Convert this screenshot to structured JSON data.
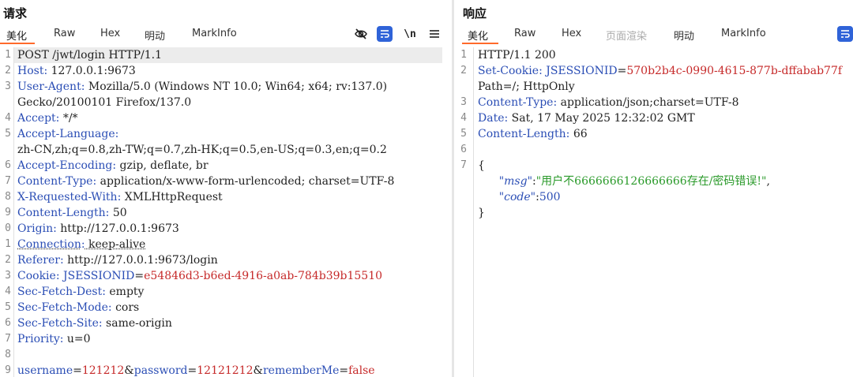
{
  "request": {
    "title": "请求",
    "tabs": [
      "美化",
      "Raw",
      "Hex",
      "明动",
      "MarkInfo"
    ],
    "active_tab": "美化",
    "toolbar": {
      "wrap_symbol": "\\n"
    },
    "lines": [
      {
        "num": "1",
        "text": "POST /jwt/login HTTP/1.1"
      },
      {
        "num": "2",
        "key": "Host",
        "value": " 127.0.0.1:9673"
      },
      {
        "num": "3",
        "key": "User-Agent",
        "value": " Mozilla/5.0 (Windows NT 10.0; Win64; x64; rv:137.0)"
      },
      {
        "num": "",
        "text": "Gecko/20100101 Firefox/137.0"
      },
      {
        "num": "4",
        "key": "Accept",
        "value": " */*"
      },
      {
        "num": "5",
        "key": "Accept-Language",
        "value": ""
      },
      {
        "num": "",
        "text": "zh-CN,zh;q=0.8,zh-TW;q=0.7,zh-HK;q=0.5,en-US;q=0.3,en;q=0.2"
      },
      {
        "num": "6",
        "key": "Accept-Encoding",
        "value": " gzip, deflate, br"
      },
      {
        "num": "7",
        "key": "Content-Type",
        "value": " application/x-www-form-urlencoded; charset=UTF-8"
      },
      {
        "num": "8",
        "key": "X-Requested-With",
        "value": " XMLHttpRequest"
      },
      {
        "num": "9",
        "key": "Content-Length",
        "value": " 50"
      },
      {
        "num": "0",
        "key": "Origin",
        "value": " http://127.0.0.1:9673"
      },
      {
        "num": "1",
        "key": "Connection",
        "value": " keep-alive"
      },
      {
        "num": "2",
        "key": "Referer",
        "value": " http://127.0.0.1:9673/login"
      },
      {
        "num": "3",
        "key": "Cookie",
        "value": " ",
        "cookie_name": "JSESSIONID",
        "cookie_eq": "=",
        "cookie_value": "e54846d3-b6ed-4916-a0ab-784b39b15510"
      },
      {
        "num": "4",
        "key": "Sec-Fetch-Dest",
        "value": " empty"
      },
      {
        "num": "5",
        "key": "Sec-Fetch-Mode",
        "value": " cors"
      },
      {
        "num": "6",
        "key": "Sec-Fetch-Site",
        "value": " same-origin"
      },
      {
        "num": "7",
        "key": "Priority",
        "value": " u=0"
      },
      {
        "num": "8",
        "text": ""
      },
      {
        "num": "9",
        "params": [
          {
            "k": "username",
            "v": "121212"
          },
          {
            "k": "password",
            "v": "12121212"
          },
          {
            "k": "rememberMe",
            "v": "false"
          }
        ]
      }
    ]
  },
  "response": {
    "title": "响应",
    "tabs": [
      "美化",
      "Raw",
      "Hex",
      "页面渲染",
      "明动",
      "MarkInfo"
    ],
    "active_tab": "美化",
    "lines": [
      {
        "num": "1",
        "text": "HTTP/1.1 200"
      },
      {
        "num": "2",
        "key": "Set-Cookie",
        "value": " ",
        "cookie_name": "JSESSIONID",
        "cookie_eq": "=",
        "cookie_value": "570b2b4c-0990-4615-877b-dffabab77f"
      },
      {
        "num": "",
        "text": "Path=/; HttpOnly"
      },
      {
        "num": "3",
        "key": "Content-Type",
        "value": " application/json;charset=UTF-8"
      },
      {
        "num": "4",
        "key": "Date",
        "value": " Sat, 17 May 2025 12:32:02 GMT"
      },
      {
        "num": "5",
        "key": "Content-Length",
        "value": " 66"
      },
      {
        "num": "6",
        "text": ""
      },
      {
        "num": "7",
        "text": "{"
      },
      {
        "num": "",
        "json": {
          "key": "\"msg\"",
          "sep": ":",
          "val": "\"用户不6666666126666666存在/密码错误!\"",
          "tail": ","
        }
      },
      {
        "num": "",
        "json": {
          "key": "\"code\"",
          "sep": ":",
          "val": "500",
          "tail": "",
          "numeric": true
        }
      },
      {
        "num": "",
        "text": "}"
      }
    ]
  }
}
